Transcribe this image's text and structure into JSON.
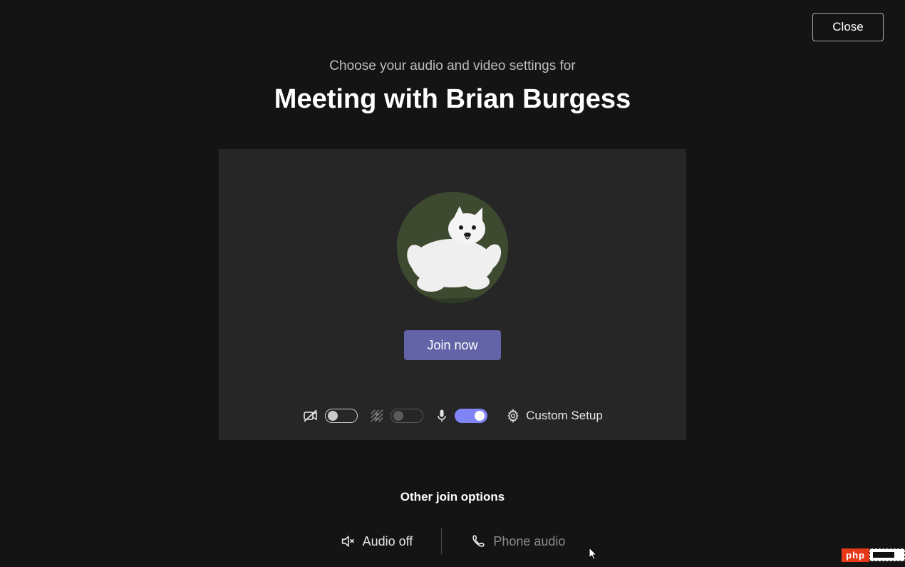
{
  "close_label": "Close",
  "header": {
    "subtitle": "Choose your audio and video settings for",
    "title": "Meeting with Brian Burgess"
  },
  "join_label": "Join now",
  "controls": {
    "camera": {
      "on": false
    },
    "background": {
      "on": false
    },
    "mic": {
      "on": true
    },
    "custom_setup_label": "Custom Setup"
  },
  "other": {
    "title": "Other join options",
    "audio_off_label": "Audio off",
    "phone_audio_label": "Phone audio"
  },
  "watermark": {
    "text": "php"
  },
  "colors": {
    "accent": "#6264a7",
    "toggle_on": "#7f85f5",
    "panel_bg": "#262626",
    "page_bg": "#141414"
  }
}
